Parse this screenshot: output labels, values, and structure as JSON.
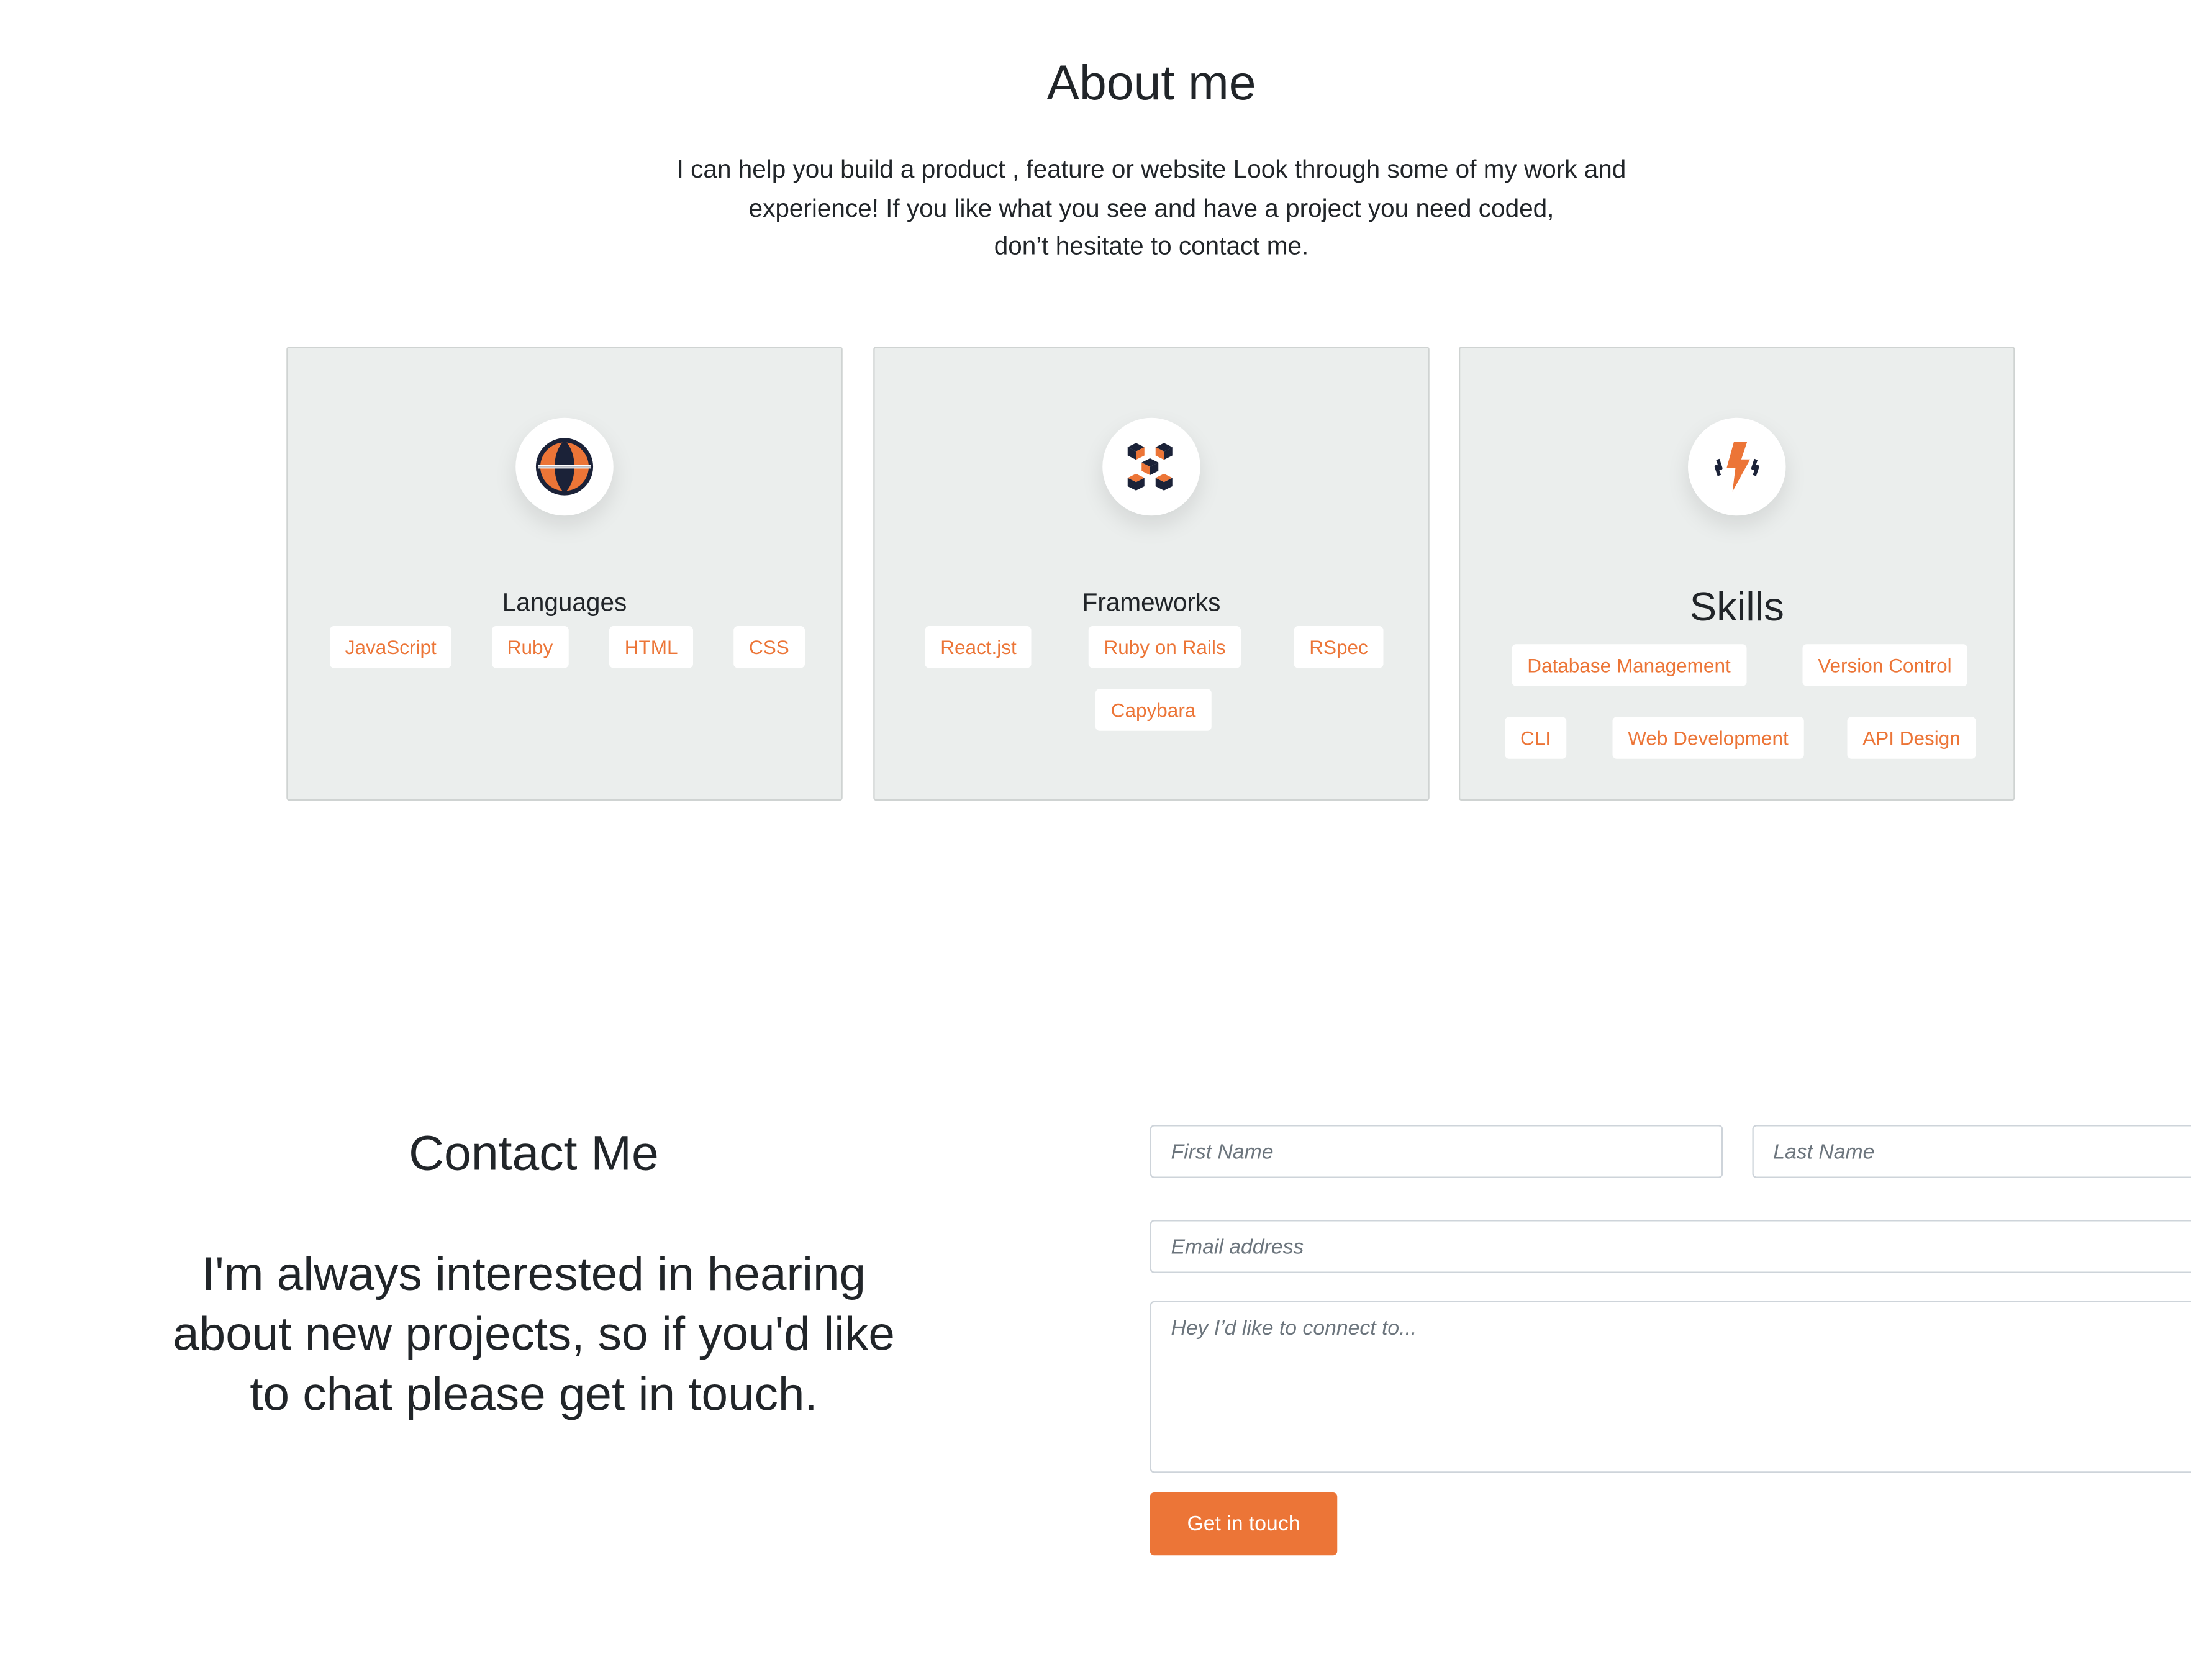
{
  "about": {
    "title": "About me",
    "text_lines": [
      "I can help you build a product , feature or website Look through some of my work and",
      "experience! If you like what you see and have a project you need coded,",
      "don’t hesitate to contact me."
    ]
  },
  "cards": {
    "languages": {
      "title": "Languages",
      "icon": "globe-icon",
      "tags": [
        "JavaScript",
        "Ruby",
        "HTML",
        "CSS"
      ]
    },
    "frameworks": {
      "title": "Frameworks",
      "icon": "blocks-icon",
      "tags": [
        "React.jst",
        "Ruby on Rails",
        "RSpec",
        "Capybara"
      ]
    },
    "skills": {
      "title": "Skills",
      "icon": "lightning-icon",
      "tags": [
        "Database Management",
        "Version Control",
        "CLI",
        "Web Development",
        "API Design"
      ]
    }
  },
  "contact": {
    "title": "Contact Me",
    "text_lines": [
      "I'm always interested in hearing",
      "about new projects, so if you'd like",
      "to chat please get in touch."
    ],
    "first_name_placeholder": "First Name",
    "last_name_placeholder": "Last Name",
    "email_placeholder": "Email address",
    "message_placeholder": "Hey I’d like to connect to...",
    "submit_label": "Get in touch"
  },
  "colors": {
    "accent": "#ec7537",
    "navy": "#1b2238",
    "card_bg": "#ebeeed"
  }
}
